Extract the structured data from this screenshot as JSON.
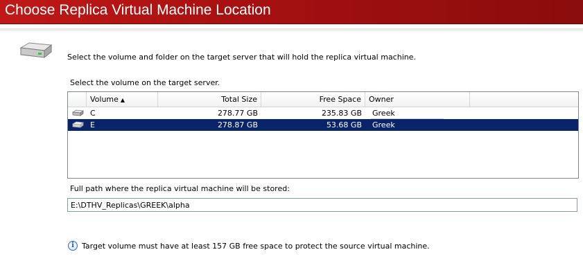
{
  "banner": {
    "title": "Choose Replica Virtual Machine Location"
  },
  "intro_text": "Select the volume and folder on the target server that will hold the replica virtual machine.",
  "volume_section": {
    "label": "Select the volume on the target server.",
    "columns": [
      {
        "label": "Volume",
        "sorted": "ascending"
      },
      {
        "label": "Total Size"
      },
      {
        "label": "Free Space"
      },
      {
        "label": "Owner"
      }
    ],
    "rows": [
      {
        "icon": "drive-icon",
        "volume": "C",
        "total_size": "278.77 GB",
        "free_space": "235.83 GB",
        "owner": "Greek",
        "selected": false
      },
      {
        "icon": "drive-icon",
        "volume": "E",
        "total_size": "278.87 GB",
        "free_space": "53.68 GB",
        "owner": "Greek",
        "selected": true
      }
    ]
  },
  "path_section": {
    "label": "Full path where the replica virtual machine will be stored:",
    "value": "E:\\DTHV_Replicas\\GREEK\\alpha"
  },
  "info_message": "Target volume must have at least 157 GB free space to protect the source virtual machine.",
  "colors": {
    "banner_red": "#a51010",
    "selection_blue": "#0a246a"
  }
}
